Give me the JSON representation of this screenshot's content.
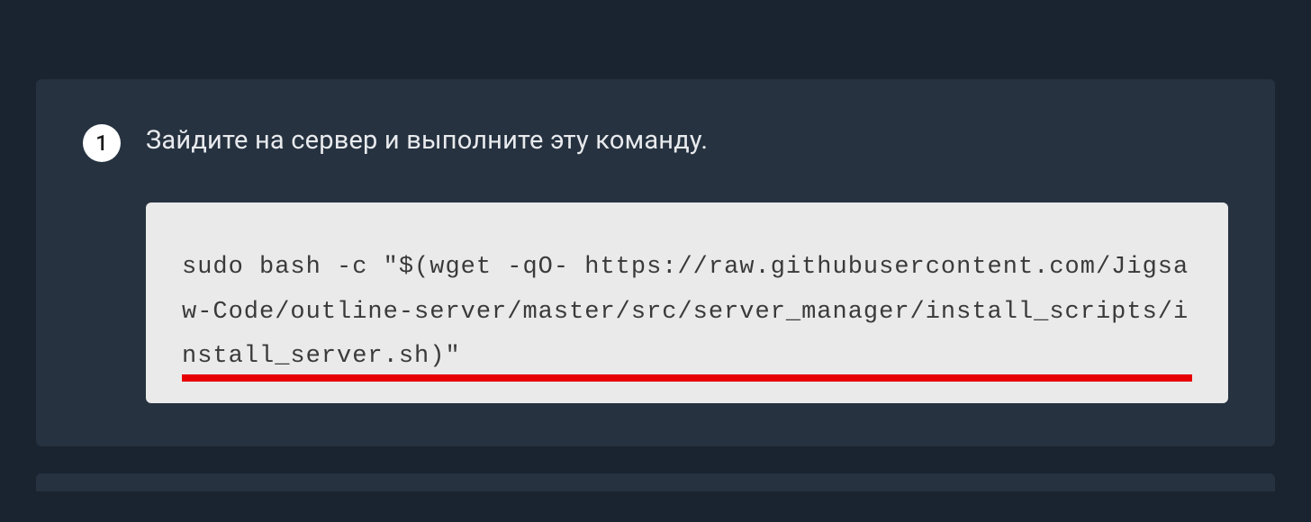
{
  "step": {
    "number": "1",
    "instruction": "Зайдите на сервер и выполните эту команду.",
    "command": "sudo bash -c \"$(wget -qO- https://raw.githubusercontent.com/Jigsaw-Code/outline-server/master/src/server_manager/install_scripts/install_server.sh)\""
  }
}
